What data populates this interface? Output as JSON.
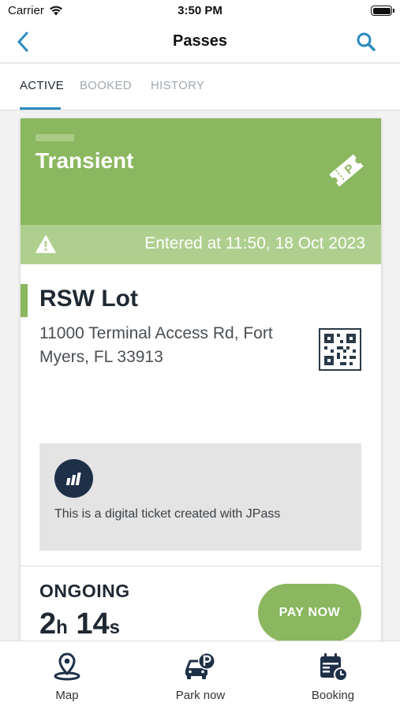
{
  "status_bar": {
    "carrier": "Carrier",
    "time": "3:50 PM"
  },
  "nav": {
    "title": "Passes",
    "back_icon": "chevron-left-icon",
    "search_icon": "search-icon"
  },
  "tabs": [
    {
      "label": "ACTIVE",
      "active": true
    },
    {
      "label": "BOOKED",
      "active": false
    },
    {
      "label": "HISTORY",
      "active": false
    }
  ],
  "pass": {
    "type": "Transient",
    "icon": "parking-ticket-icon",
    "entered": "Entered at 11:50, 18 Oct 2023",
    "lot_name": "RSW Lot",
    "address": "11000 Terminal Access Rd, Fort Myers, FL 33913",
    "info_text": "This is a digital ticket created with JPass",
    "status": "ONGOING",
    "duration": {
      "hours": "2",
      "hours_unit": "h",
      "minutes": "14",
      "minutes_unit": "s"
    },
    "pay_button": "PAY NOW"
  },
  "bottom_nav": [
    {
      "label": "Map",
      "icon": "map-pin-icon"
    },
    {
      "label": "Park now",
      "icon": "car-parking-icon"
    },
    {
      "label": "Booking",
      "icon": "calendar-clock-icon"
    }
  ],
  "colors": {
    "accent_green": "#8ab75f",
    "light_green": "#afcf8e",
    "brand_blue": "#2a8bbf",
    "navy": "#1e3048"
  }
}
